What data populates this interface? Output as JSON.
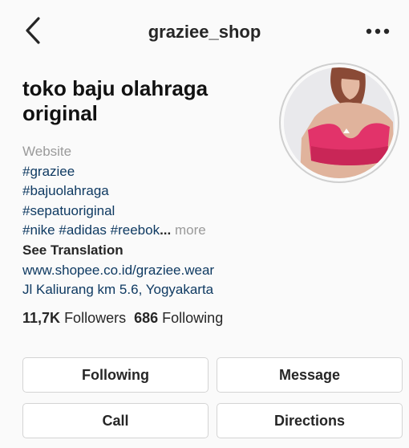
{
  "header": {
    "username": "graziee_shop",
    "back_icon": "chevron-left-icon",
    "more_icon": "more-horizontal-icon"
  },
  "profile": {
    "name": "toko baju olahraga original",
    "category": "Website",
    "bio_lines": [
      "#graziee",
      "#bajuolahraga",
      "#sepatuoriginal"
    ],
    "hashtags_line": "#nike #adidas #reebok",
    "ellipsis": "...",
    "more_label": "more",
    "see_translation": "See Translation",
    "website": "www.shopee.co.id/graziee.wear",
    "address": "Jl Kaliurang km 5.6, Yogyakarta",
    "avatar_description": "avatar-photo"
  },
  "stats": {
    "followers_count": "11,7K",
    "followers_label": "Followers",
    "following_count": "686",
    "following_label": "Following"
  },
  "actions": {
    "following": "Following",
    "message": "Message",
    "call": "Call",
    "directions": "Directions"
  },
  "colors": {
    "background": "#fafafa",
    "text": "#262626",
    "link": "#0f3a62",
    "muted": "#9a9a9a",
    "border": "#d4d4d4",
    "bra": "#e2336a"
  }
}
